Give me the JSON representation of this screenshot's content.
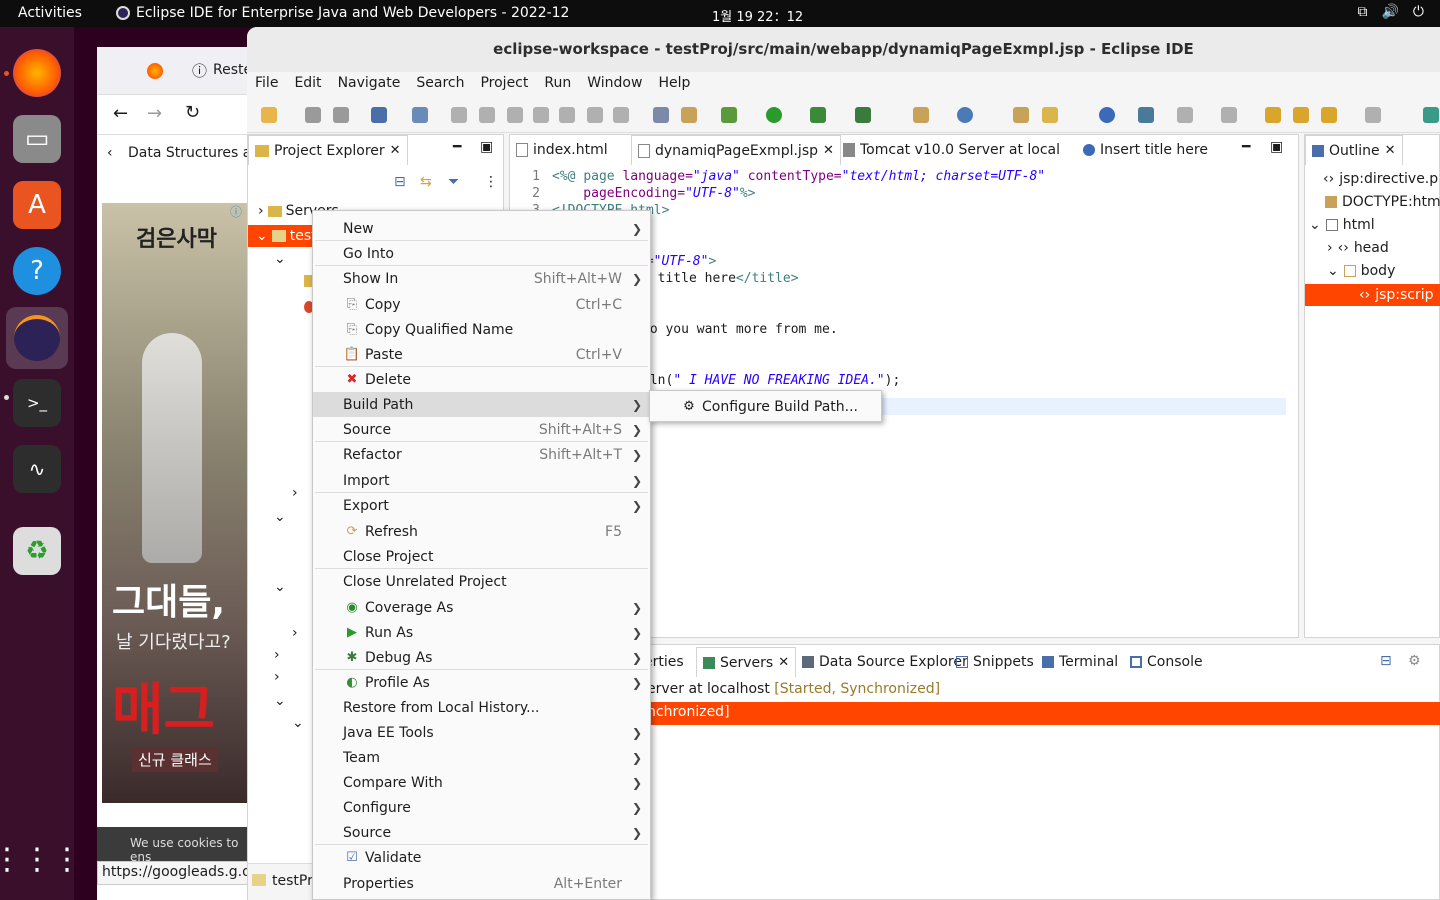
{
  "topbar": {
    "activities": "Activities",
    "app_title": "Eclipse IDE for Enterprise Java and Web Developers - 2022-12",
    "clock": "1월 19  22：12"
  },
  "firefox": {
    "tab_label": "Reste",
    "breadcrumb": "Data Structures ar",
    "ad_title": "검은사막",
    "ad_line1": "그대들,",
    "ad_line2": "날 기다렸다고?",
    "ad_big": "매그",
    "ad_badge": "신규 클래스",
    "cookie": "We use cookies to ens",
    "status_url": "https://googleads.g.do"
  },
  "eclipse": {
    "title": "eclipse-workspace - testProj/src/main/webapp/dynamiqPageExmpl.jsp - Eclipse IDE",
    "menu": [
      "File",
      "Edit",
      "Navigate",
      "Search",
      "Project",
      "Run",
      "Window",
      "Help"
    ],
    "project_explorer": {
      "tab": "Project Explorer",
      "servers": "Servers",
      "project": "testProj",
      "status": "testPr"
    },
    "editor_tabs": [
      "index.html",
      "dynamiqPageExmpl.jsp",
      "Tomcat v10.0 Server at local",
      "Insert title here"
    ],
    "code": {
      "line1_a": "<%@ ",
      "line1_b": "page ",
      "line1_c": "language=",
      "line1_d": "\"java\"",
      "line1_e": " contentType=",
      "line1_f": "\"text/html; charset=UTF-8\"",
      "line2_a": "    pageEncoding=",
      "line2_b": "\"UTF-8\"",
      "line2_c": "%>",
      "line3": "<!DOCTYPE html>",
      "frag1_a": "t=",
      "frag1_b": "\"UTF-8\"",
      "frag1_c": ">",
      "frag2_a": "t title here",
      "frag2_b": "</title>",
      "frag3": "do you want more from me.",
      "frag4_a": "tln(",
      "frag4_b": "\" I HAVE NO FREAKING IDEA.\"",
      "frag4_c": ");"
    },
    "line_numbers": [
      "1",
      "2",
      "3"
    ],
    "outline": {
      "tab": "Outline",
      "items": [
        "jsp:directive.p",
        "DOCTYPE:htm",
        "html",
        "head",
        "body",
        "jsp:scrip"
      ]
    },
    "bottom": {
      "tabs": [
        "erties",
        "Servers",
        "Data Source Explorer",
        "Snippets",
        "Terminal",
        "Console"
      ],
      "server_row": "erver at localhost",
      "server_status": "[Started, Synchronized]",
      "sub_row": "nchronized]"
    }
  },
  "context_menu": {
    "items": [
      {
        "label": "New",
        "shortcut": "",
        "submenu": true,
        "icon": ""
      },
      {
        "label": "Go Into",
        "shortcut": "",
        "submenu": false,
        "icon": ""
      },
      {
        "label": "Show In",
        "shortcut": "Shift+Alt+W",
        "submenu": true,
        "icon": ""
      },
      {
        "label": "Copy",
        "shortcut": "Ctrl+C",
        "submenu": false,
        "icon": "copy-icon"
      },
      {
        "label": "Copy Qualified Name",
        "shortcut": "",
        "submenu": false,
        "icon": "copy-qualified-icon"
      },
      {
        "label": "Paste",
        "shortcut": "Ctrl+V",
        "submenu": false,
        "icon": "paste-icon"
      },
      {
        "label": "Delete",
        "shortcut": "",
        "submenu": false,
        "icon": "delete-icon"
      },
      {
        "label": "Build Path",
        "shortcut": "",
        "submenu": true,
        "icon": ""
      },
      {
        "label": "Source",
        "shortcut": "Shift+Alt+S",
        "submenu": true,
        "icon": ""
      },
      {
        "label": "Refactor",
        "shortcut": "Shift+Alt+T",
        "submenu": true,
        "icon": ""
      },
      {
        "label": "Import",
        "shortcut": "",
        "submenu": true,
        "icon": ""
      },
      {
        "label": "Export",
        "shortcut": "",
        "submenu": true,
        "icon": ""
      },
      {
        "label": "Refresh",
        "shortcut": "F5",
        "submenu": false,
        "icon": "refresh-icon"
      },
      {
        "label": "Close Project",
        "shortcut": "",
        "submenu": false,
        "icon": ""
      },
      {
        "label": "Close Unrelated Project",
        "shortcut": "",
        "submenu": false,
        "icon": ""
      },
      {
        "label": "Coverage As",
        "shortcut": "",
        "submenu": true,
        "icon": "coverage-icon"
      },
      {
        "label": "Run As",
        "shortcut": "",
        "submenu": true,
        "icon": "run-icon"
      },
      {
        "label": "Debug As",
        "shortcut": "",
        "submenu": true,
        "icon": "debug-icon"
      },
      {
        "label": "Profile As",
        "shortcut": "",
        "submenu": true,
        "icon": "profile-icon"
      },
      {
        "label": "Restore from Local History...",
        "shortcut": "",
        "submenu": false,
        "icon": ""
      },
      {
        "label": "Java EE Tools",
        "shortcut": "",
        "submenu": true,
        "icon": ""
      },
      {
        "label": "Team",
        "shortcut": "",
        "submenu": true,
        "icon": ""
      },
      {
        "label": "Compare With",
        "shortcut": "",
        "submenu": true,
        "icon": ""
      },
      {
        "label": "Configure",
        "shortcut": "",
        "submenu": true,
        "icon": ""
      },
      {
        "label": "Source",
        "shortcut": "",
        "submenu": true,
        "icon": ""
      },
      {
        "label": "Validate",
        "shortcut": "",
        "submenu": false,
        "icon": "checkbox-checked-icon"
      },
      {
        "label": "Properties",
        "shortcut": "Alt+Enter",
        "submenu": false,
        "icon": ""
      }
    ],
    "highlighted": "Build Path",
    "submenu_item": "Configure Build Path..."
  },
  "colors": {
    "accent_orange": "#ff4500",
    "highlight_gray": "#dcdcdc",
    "ubuntu_dock": "#3a0f2c"
  }
}
